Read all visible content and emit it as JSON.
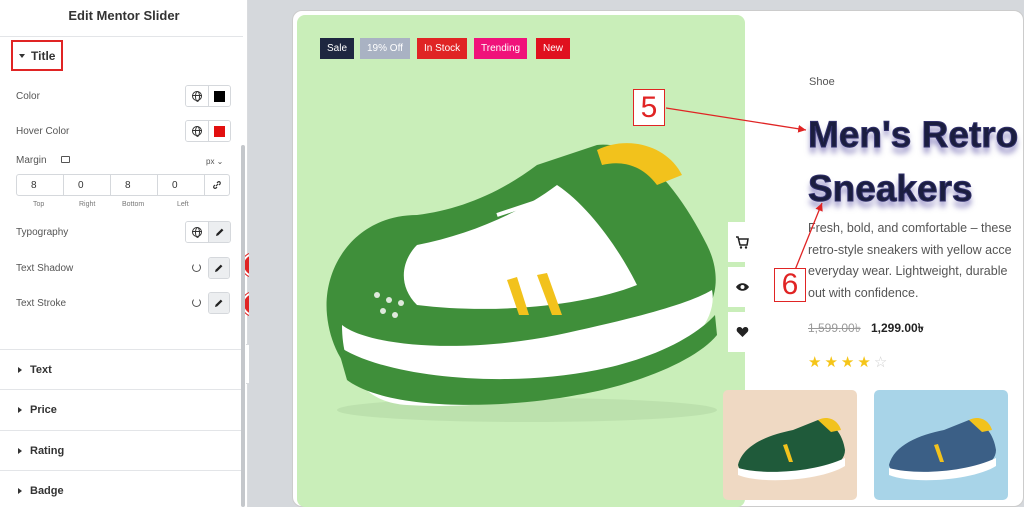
{
  "panel": {
    "title": "Edit Mentor Slider",
    "section_title": "Title",
    "color_label": "Color",
    "color_value": "#000000",
    "hover_color_label": "Hover Color",
    "hover_color_value": "#e20f0f",
    "margin_label": "Margin",
    "margin_unit": "px",
    "margin": {
      "top": "8",
      "right": "0",
      "bottom": "8",
      "left": "0",
      "top_caption": "Top",
      "right_caption": "Right",
      "bottom_caption": "Bottom",
      "left_caption": "Left"
    },
    "typography_label": "Typography",
    "text_shadow_label": "Text Shadow",
    "text_stroke_label": "Text Stroke",
    "marker_shadow": "5",
    "marker_stroke": "6",
    "collapsed_sections": [
      "Text",
      "Price",
      "Rating",
      "Badge"
    ]
  },
  "product": {
    "badges": [
      {
        "label": "Sale",
        "color": "#1e2740"
      },
      {
        "label": "19% Off",
        "color": "#a9b2c3"
      },
      {
        "label": "In Stock",
        "color": "#e02424"
      },
      {
        "label": "Trending",
        "color": "#f0127a"
      },
      {
        "label": "New",
        "color": "#e0101f"
      }
    ],
    "category": "Shoe",
    "title_line1": "Men's Retro",
    "title_line2": "Sneakers",
    "desc_line1": "Fresh, bold, and comfortable – these",
    "desc_line2": "retro-style sneakers with yellow acce",
    "desc_line3": "everyday wear. Lightweight, durable",
    "desc_line4": "out with confidence.",
    "old_price": "1,599.00৳",
    "new_price": "1,299.00৳",
    "rating": 4,
    "rating_max": 5,
    "actions": [
      "cart-icon",
      "eye-icon",
      "heart-icon"
    ]
  },
  "annotations": {
    "box5": "5",
    "box6": "6"
  },
  "colors": {
    "accent_red": "#e02424",
    "hero_bg": "#c9eeb9",
    "star": "#f5c518"
  }
}
